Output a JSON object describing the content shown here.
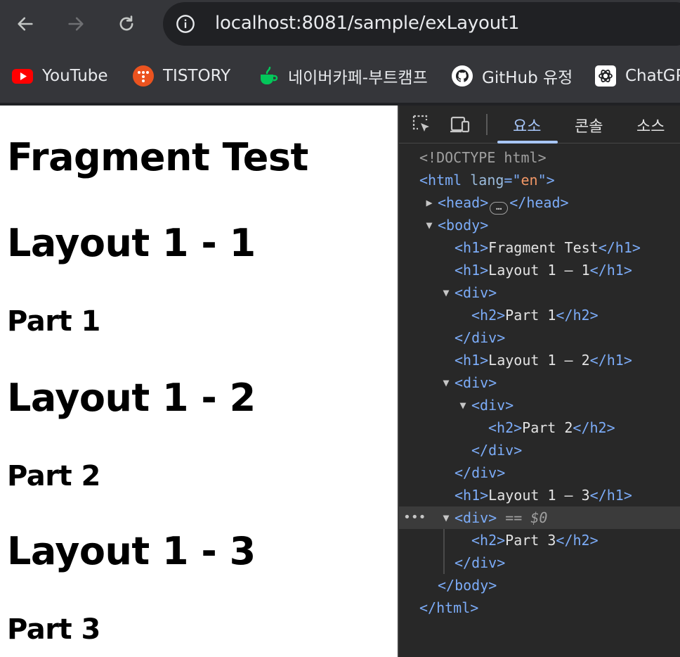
{
  "browser": {
    "url": "localhost:8081/sample/exLayout1",
    "bookmarks": [
      {
        "label": "YouTube",
        "icon": "youtube-icon"
      },
      {
        "label": "TISTORY",
        "icon": "tistory-icon"
      },
      {
        "label": "네이버카페-부트캠프",
        "icon": "naver-cafe-icon"
      },
      {
        "label": "GitHub 유정",
        "icon": "github-icon"
      },
      {
        "label": "ChatGP",
        "icon": "chatgpt-icon"
      }
    ]
  },
  "page": {
    "h1_title": "Fragment Test",
    "layout1": "Layout 1 - 1",
    "part1": "Part 1",
    "layout2": "Layout 1 - 2",
    "part2": "Part 2",
    "layout3": "Layout 1 - 3",
    "part3": "Part 3"
  },
  "devtools": {
    "tabs": [
      "요소",
      "콘솔",
      "소스"
    ],
    "active_tab": "요소",
    "lines": {
      "doctype": "<!DOCTYPE html>",
      "html_open_tag": "<html ",
      "html_attr": "lang",
      "html_eq": "=\"",
      "html_attr_val": "en",
      "html_close_bracket": "\">",
      "head_open": "<head>",
      "head_pill": "…",
      "head_close": "</head>",
      "body_open": "<body>",
      "h1a_open": "<h1>",
      "h1a_text": "Fragment Test",
      "h1a_close": "</h1>",
      "h1b_open": "<h1>",
      "h1b_text": "Layout 1 – 1",
      "h1b_close": "</h1>",
      "div1_open": "<div>",
      "h2a_open": "<h2>",
      "h2a_text": "Part 1",
      "h2a_close": "</h2>",
      "div1_close": "</div>",
      "h1c_open": "<h1>",
      "h1c_text": "Layout 1 – 2",
      "h1c_close": "</h1>",
      "div2_open": "<div>",
      "div3_open": "<div>",
      "h2b_open": "<h2>",
      "h2b_text": "Part 2",
      "h2b_close": "</h2>",
      "div3_close": "</div>",
      "div2_close": "</div>",
      "h1d_open": "<h1>",
      "h1d_text": "Layout 1 – 3",
      "h1d_close": "</h1>",
      "div4_open": "<div>",
      "div4_marker": " == $0",
      "h2c_open": "<h2>",
      "h2c_text": "Part 3",
      "h2c_close": "</h2>",
      "div4_close": "</div>",
      "body_close": "</body>",
      "html_close": "</html>",
      "row_dots": "•••"
    }
  },
  "colors": {
    "toolbar_bg": "#35363a",
    "devtools_bg": "#282828",
    "tag": "#7cacf8",
    "attr_value": "#f29766",
    "active_tab": "#a8c7fa"
  }
}
